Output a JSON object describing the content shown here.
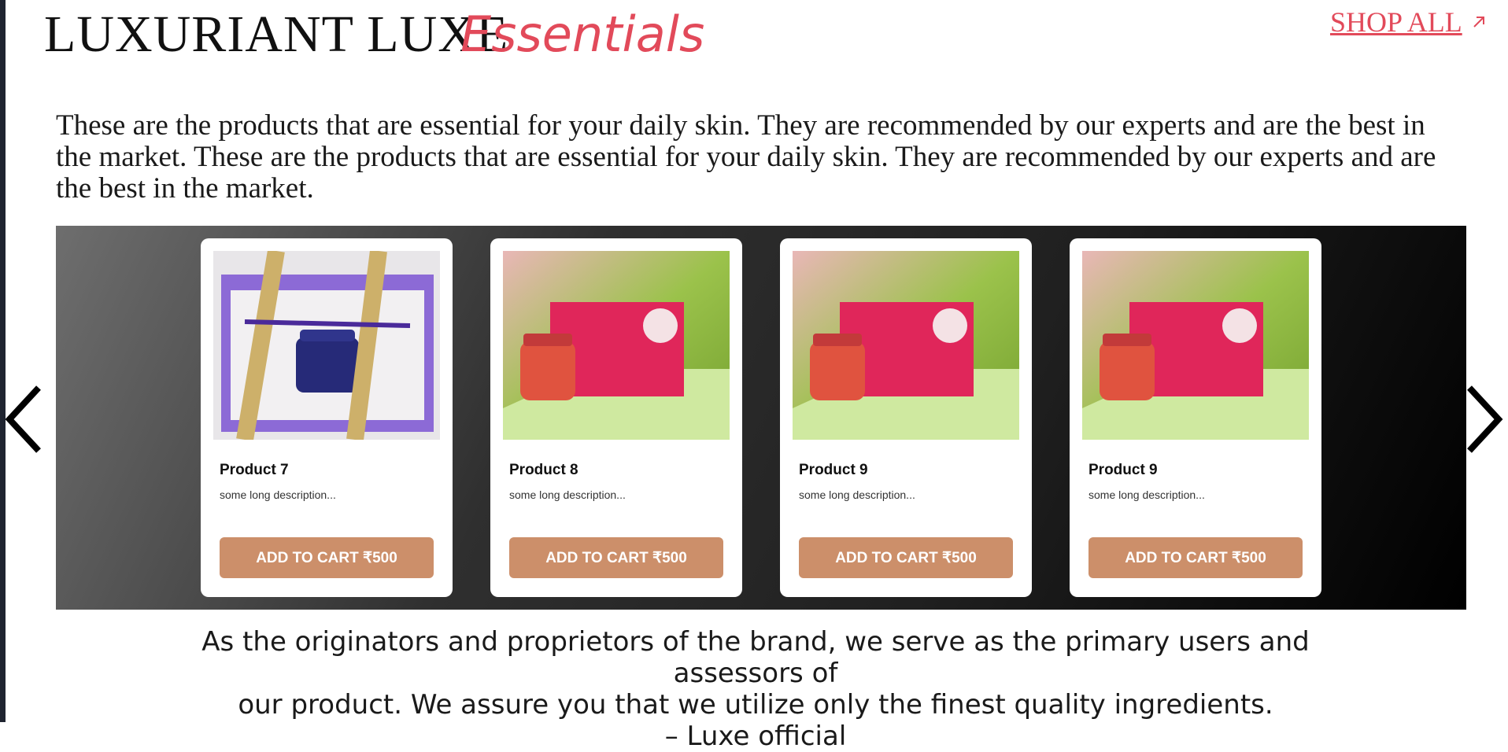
{
  "header": {
    "brand": "LUXURIANT LUXE",
    "accent": "Essentials",
    "shop_all": "SHOP ALL"
  },
  "intro": "These are the products that are essential for your daily skin. They are recommended by our experts and are the best in the market. These are the products that are essential for your daily skin. They are recommended by our experts and are the best in the market.",
  "products": [
    {
      "title": "Product 7",
      "desc": "some long description...",
      "button": "ADD TO CART ₹500",
      "image": "purple-gift-box-jar"
    },
    {
      "title": "Product 8",
      "desc": "some long description...",
      "button": "ADD TO CART ₹500",
      "image": "luxe-pink-box-jar"
    },
    {
      "title": "Product 9",
      "desc": "some long description...",
      "button": "ADD TO CART ₹500",
      "image": "luxe-pink-box-jar"
    },
    {
      "title": "Product 9",
      "desc": "some long description...",
      "button": "ADD TO CART ₹500",
      "image": "luxe-pink-box-jar"
    }
  ],
  "quote": {
    "line1": "As the originators and proprietors of the brand, we serve as the primary users and assessors of",
    "line2": "our product. We assure you that we utilize only the finest quality ingredients.",
    "line3": "– Luxe official"
  },
  "colors": {
    "accent": "#e24a5a",
    "button": "#cc8f6a"
  },
  "icons": {
    "prev": "chevron-left-icon",
    "next": "chevron-right-icon",
    "shop_all": "arrow-up-right-icon"
  }
}
